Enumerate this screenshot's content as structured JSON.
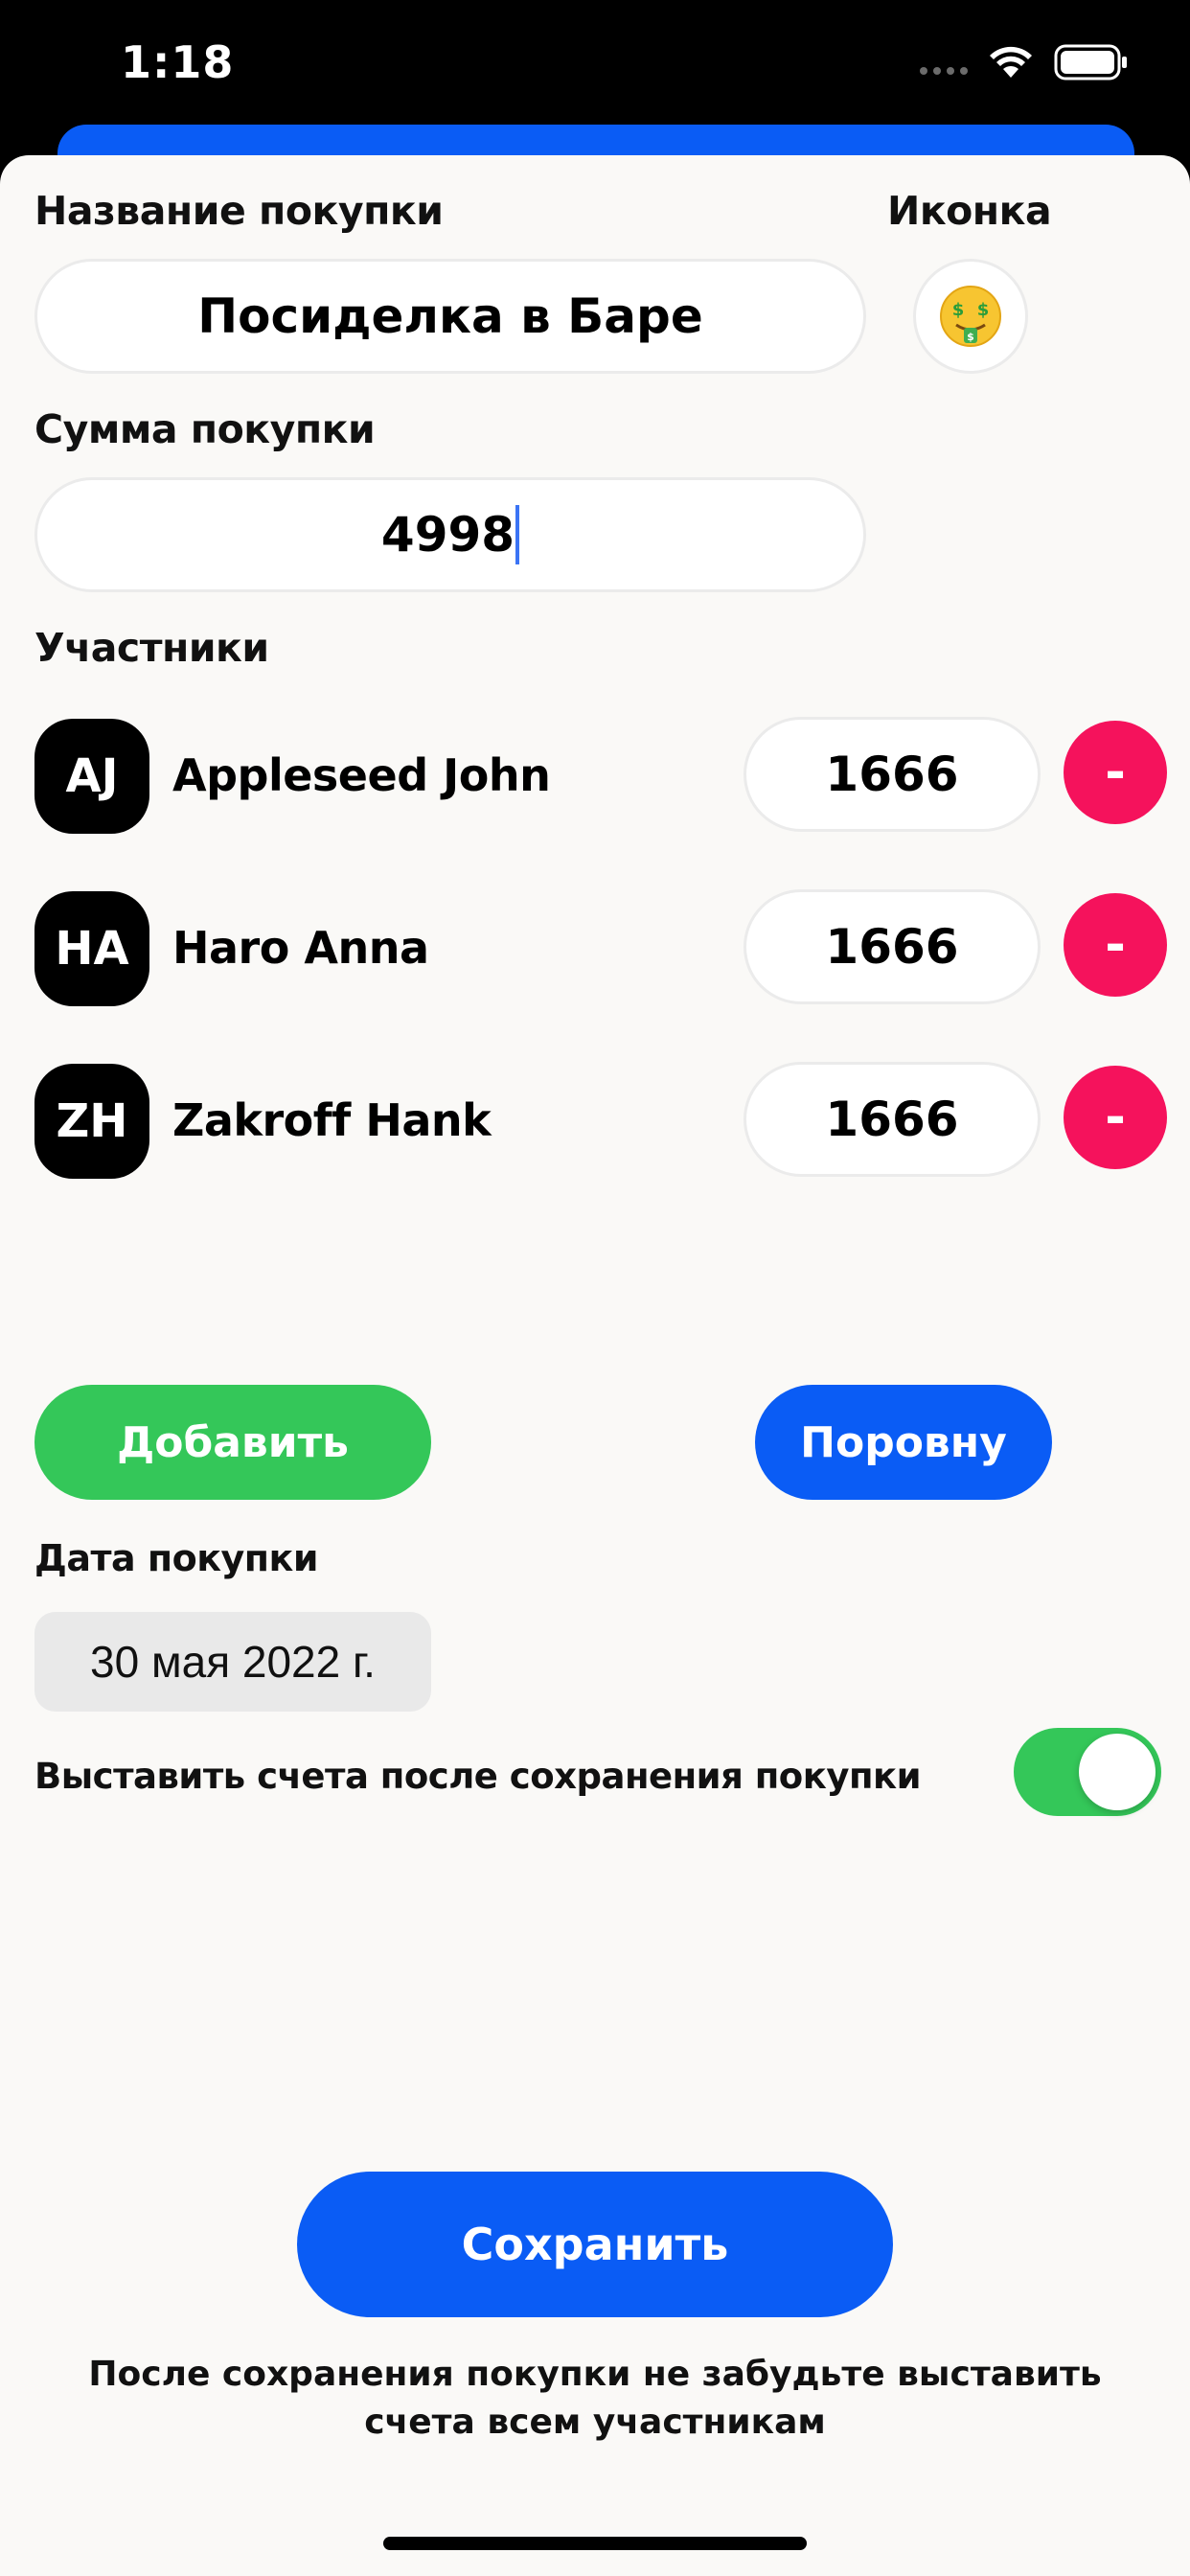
{
  "status_bar": {
    "time": "1:18"
  },
  "form": {
    "title_label": "Название покупки",
    "title_value": "Посиделка в Баре",
    "icon_label": "Иконка",
    "icon_emoji": "🤑",
    "amount_label": "Сумма покупки",
    "amount_value": "4998",
    "participants_label": "Участники",
    "participants": [
      {
        "initials": "AJ",
        "name": "Appleseed John",
        "amount": "1666",
        "remove_label": "-"
      },
      {
        "initials": "HA",
        "name": "Haro Anna",
        "amount": "1666",
        "remove_label": "-"
      },
      {
        "initials": "ZH",
        "name": "Zakroff Hank",
        "amount": "1666",
        "remove_label": "-"
      }
    ],
    "add_label": "Добавить",
    "split_equally_label": "Поровну",
    "date_label": "Дата покупки",
    "date_value": "30 мая 2022 г.",
    "send_bills_label": "Выставить счета после сохранения покупки",
    "send_bills_enabled": true,
    "save_label": "Сохранить",
    "footer_note_line1": "После сохранения покупки не забудьте выставить",
    "footer_note_line2": "счета всем участникам"
  },
  "colors": {
    "primary_blue": "#0a5cf5",
    "add_green": "#34c759",
    "remove_red": "#f5125c",
    "background": "#faf9f7"
  }
}
